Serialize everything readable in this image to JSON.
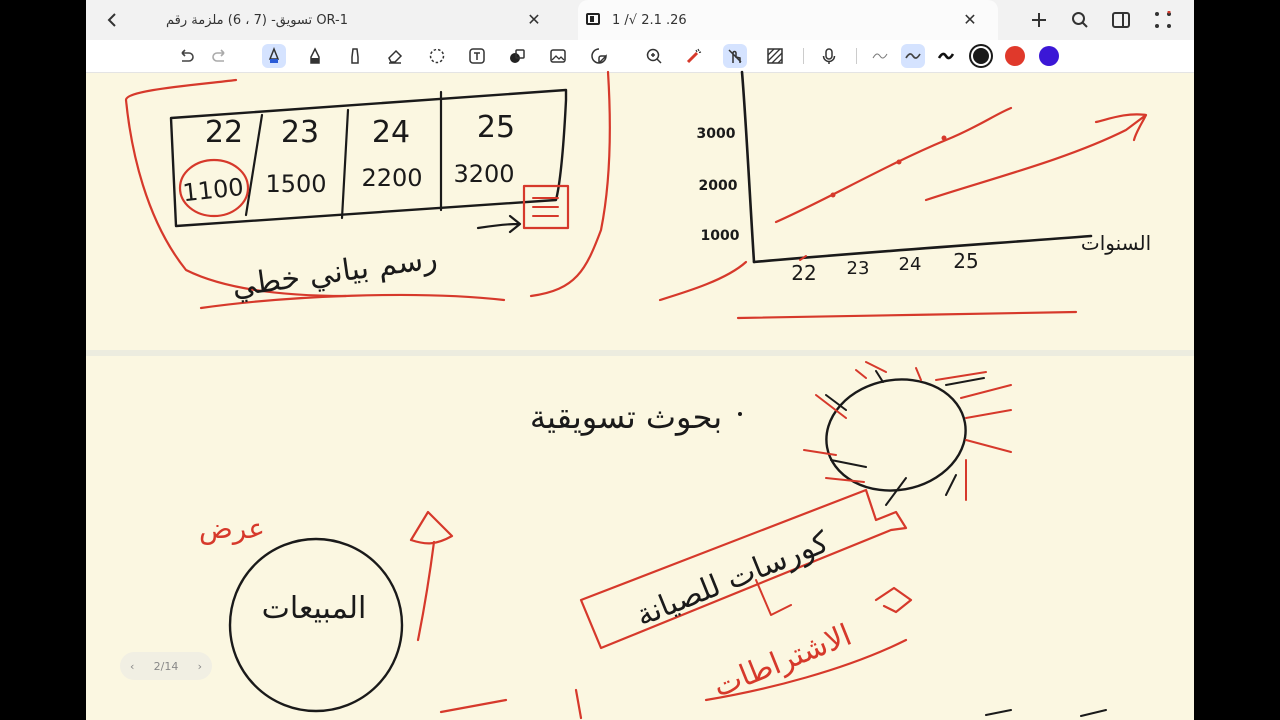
{
  "tabs": [
    {
      "label": "تسويق- (7 ، 6) ملزمة رقم OR-1",
      "active": false
    },
    {
      "label": "1 /√ 2.1 .26",
      "active": true
    }
  ],
  "toolbar": {
    "tools": [
      "undo-icon",
      "redo-icon",
      "pen-icon",
      "fountain-pen-icon",
      "highlighter-icon",
      "eraser-icon",
      "lasso-icon",
      "text-icon",
      "shapes-icon",
      "image-icon",
      "sticker-icon",
      "zoom-icon",
      "laser-icon",
      "touch-write-icon",
      "pattern-icon",
      "mic-icon"
    ],
    "stroke_colors": [
      "#1a1a1a",
      "#e0392b",
      "#3b17d6"
    ]
  },
  "pager": {
    "label": "2/14"
  },
  "page1": {
    "table": {
      "years": [
        "22",
        "23",
        "24",
        "25"
      ],
      "values": [
        "1100",
        "1500",
        "2200",
        "3200"
      ]
    },
    "caption": "رسم بياني خطي",
    "chart": {
      "y_labels": [
        "3000",
        "2000",
        "1000"
      ],
      "x_labels": [
        "22",
        "23",
        "24",
        "25"
      ],
      "x_title": "السنوات"
    }
  },
  "page2": {
    "heading": "بحوث تسويقية",
    "circle_label": "المبيعات",
    "side_word": "عرض",
    "banner": "كورسات للصيانة",
    "sub_note": "الاشتراطات"
  },
  "colors": {
    "ink": "#1a1a1a",
    "red": "#d6392b",
    "paper": "#fbf7e1"
  }
}
